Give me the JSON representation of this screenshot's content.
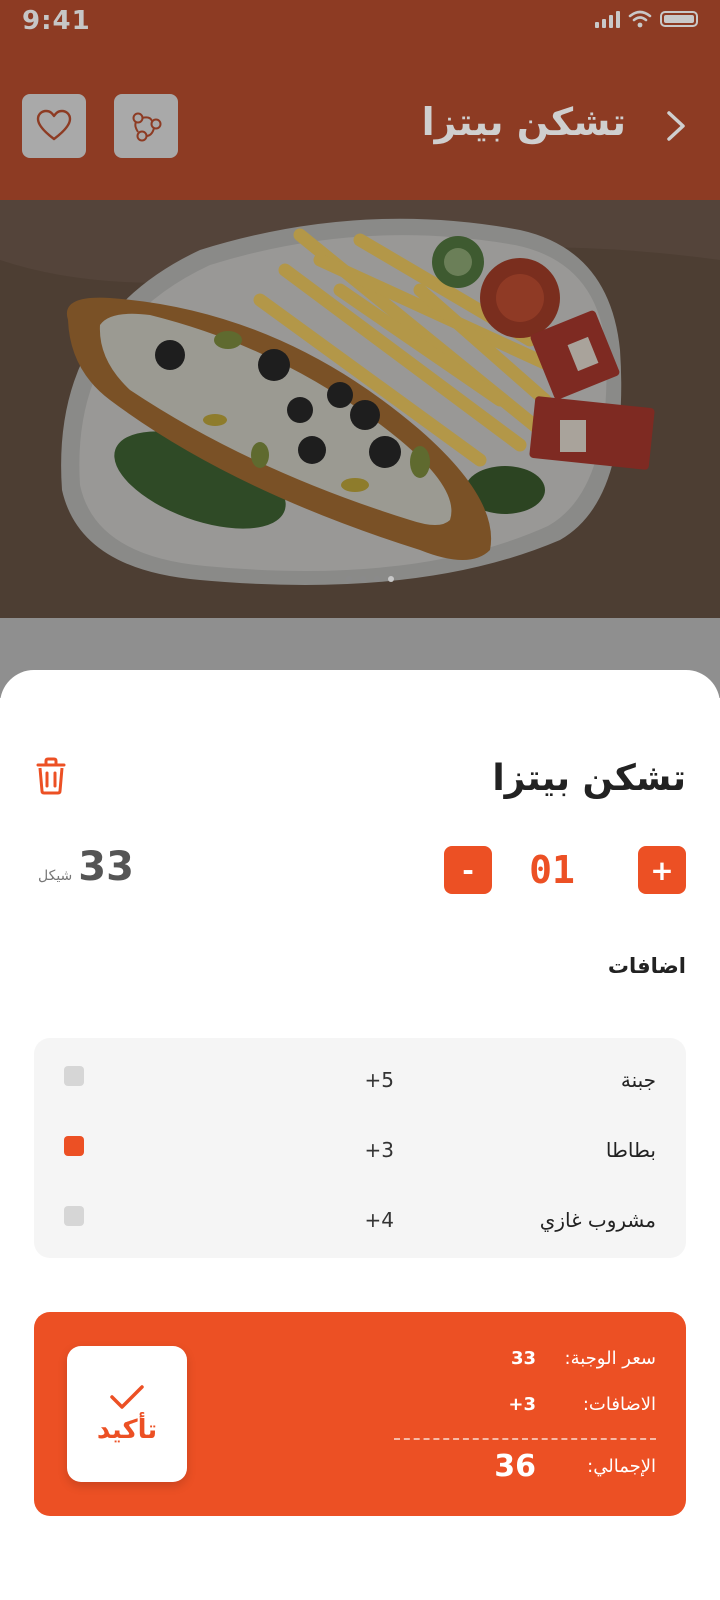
{
  "status_bar": {
    "time": "9:41"
  },
  "header": {
    "title": "تشكن بيتزا"
  },
  "icons": {
    "back": "chevron-right-icon",
    "share": "share-icon",
    "favorite": "heart-icon",
    "delete": "trash-icon",
    "confirm": "check-icon"
  },
  "carousel": {
    "dots": 4,
    "active": 4
  },
  "item": {
    "name": "تشكن بيتزا",
    "quantity": "01",
    "plus_label": "+",
    "minus_label": "-",
    "price": "33",
    "currency": "شيكل"
  },
  "extras": {
    "title": "اضافات",
    "items": [
      {
        "name": "جبنة",
        "price": "+5",
        "checked": false
      },
      {
        "name": "بطاطا",
        "price": "+3",
        "checked": true
      },
      {
        "name": "مشروب غازي",
        "price": "+4",
        "checked": false
      }
    ]
  },
  "summary": {
    "meal_label": "سعر الوجبة:",
    "meal_value": "33",
    "extras_label": "الاضافات:",
    "extras_value": "+3",
    "total_label": "الإجمالي:",
    "total_value": "36",
    "confirm_label": "تأكيد"
  },
  "colors": {
    "accent": "#EC5024",
    "header_dimmed": "#8D3B23",
    "checkbox_off": "#D6D6D6",
    "panel_bg": "#F5F5F5"
  }
}
